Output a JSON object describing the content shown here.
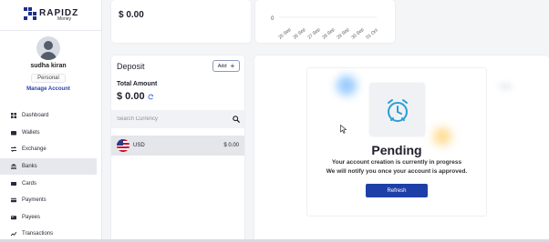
{
  "brand": {
    "name": "RAPIDZ",
    "sub": "Money",
    "accent": "#1f3fa8"
  },
  "user": {
    "name": "sudha kiran",
    "role": "Personal",
    "manage_label": "Manage Account"
  },
  "sidebar": {
    "items": [
      {
        "label": "Dashboard",
        "icon": "dashboard-icon",
        "active": false
      },
      {
        "label": "Wallets",
        "icon": "wallet-icon",
        "active": false
      },
      {
        "label": "Exchange",
        "icon": "exchange-icon",
        "active": false
      },
      {
        "label": "Banks",
        "icon": "bank-icon",
        "active": true
      },
      {
        "label": "Cards",
        "icon": "card-icon",
        "active": false
      },
      {
        "label": "Payments",
        "icon": "payments-icon",
        "active": false
      },
      {
        "label": "Payees",
        "icon": "payees-icon",
        "active": false
      },
      {
        "label": "Transactions",
        "icon": "transactions-icon",
        "active": false
      }
    ]
  },
  "top_card": {
    "balance": "$ 0.00"
  },
  "top_chart": {
    "y_tick": "0",
    "x_ticks": [
      "25 Sep",
      "26 Sep",
      "27 Sep",
      "28 Sep",
      "29 Sep",
      "30 Sep",
      "01 Oct"
    ]
  },
  "deposit": {
    "title": "Deposit",
    "add_label": "Add",
    "total_label": "Total Amount",
    "total_value": "$ 0.00",
    "search_placeholder": "Search Currency",
    "currencies": [
      {
        "code": "USD",
        "amount": "$ 0.00"
      }
    ]
  },
  "pending": {
    "title": "Pending",
    "line1": "Your account creation is currently in progress",
    "line2": "We will notify you once your account is approved.",
    "refresh_label": "Refresh"
  }
}
